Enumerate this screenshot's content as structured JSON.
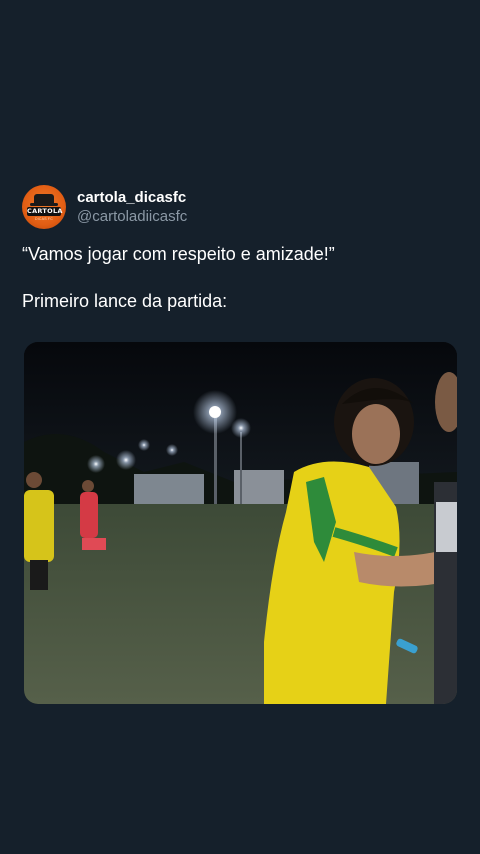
{
  "author": {
    "display_name": "cartola_dicasfc",
    "handle": "@cartoladiicasfc",
    "avatar_text": "CARTOLA",
    "avatar_subtext": "DICAS FC"
  },
  "tweet": {
    "line1": "“Vamos jogar com respeito e amizade!”",
    "line2": "Primeiro lance da partida:"
  },
  "colors": {
    "background": "#15202b",
    "handle": "#8b98a5",
    "avatar": "#e25e14",
    "jersey_yellow": "#e6d117",
    "jersey_green": "#2e8b3a"
  },
  "media": {
    "type": "video",
    "description_icon": "football-video-frame"
  }
}
